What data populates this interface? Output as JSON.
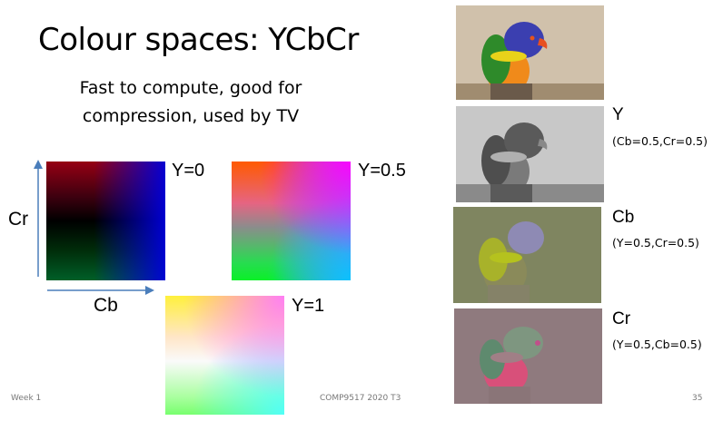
{
  "slide": {
    "title": "Colour spaces: YCbCr",
    "subtitle_line1": "Fast to compute, good for",
    "subtitle_line2": "compression, used by TV"
  },
  "squares": [
    {
      "label": "Y=0"
    },
    {
      "label": "Y=0.5"
    },
    {
      "label": "Y=1"
    }
  ],
  "axes": {
    "vertical": "Cr",
    "horizontal": "Cb"
  },
  "channels": [
    {
      "name": "Y",
      "sub": "(Cb=0.5,Cr=0.5)"
    },
    {
      "name": "Cb",
      "sub": "(Y=0.5,Cr=0.5)"
    },
    {
      "name": "Cr",
      "sub": "(Y=0.5,Cb=0.5)"
    }
  ],
  "footer": {
    "left": "Week 1",
    "center": "COMP9517 2020 T3",
    "page": "35"
  },
  "colors": {
    "axis_arrow": "#4a7ebb",
    "cb_background": "#7f8560",
    "cr_background": "#8f7a7e"
  }
}
